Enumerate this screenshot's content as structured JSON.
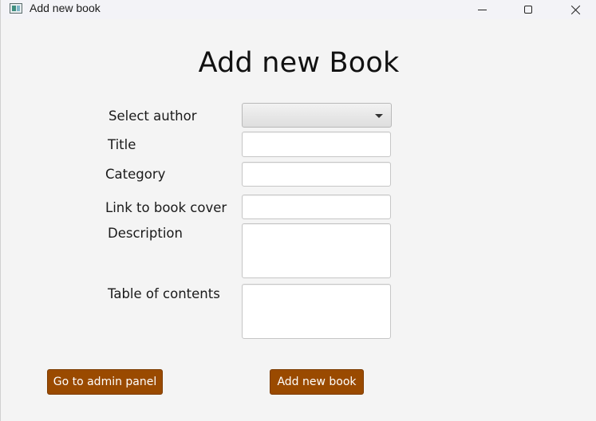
{
  "window": {
    "title": "Add new book"
  },
  "form": {
    "heading": "Add new Book",
    "labels": {
      "author": "Select author",
      "title": "Title",
      "category": "Category",
      "cover": "Link to book cover",
      "description": "Description",
      "toc": "Table of contents"
    },
    "values": {
      "author": "",
      "title": "",
      "category": "",
      "cover": "",
      "description": "",
      "toc": ""
    }
  },
  "buttons": {
    "admin": "Go to admin panel",
    "add": "Add new book"
  },
  "colors": {
    "button_bg": "#9a4a00",
    "button_text": "#ffffff"
  },
  "icons": [
    "app-icon",
    "minimize-icon",
    "maximize-icon",
    "close-icon",
    "chevron-down-icon"
  ]
}
